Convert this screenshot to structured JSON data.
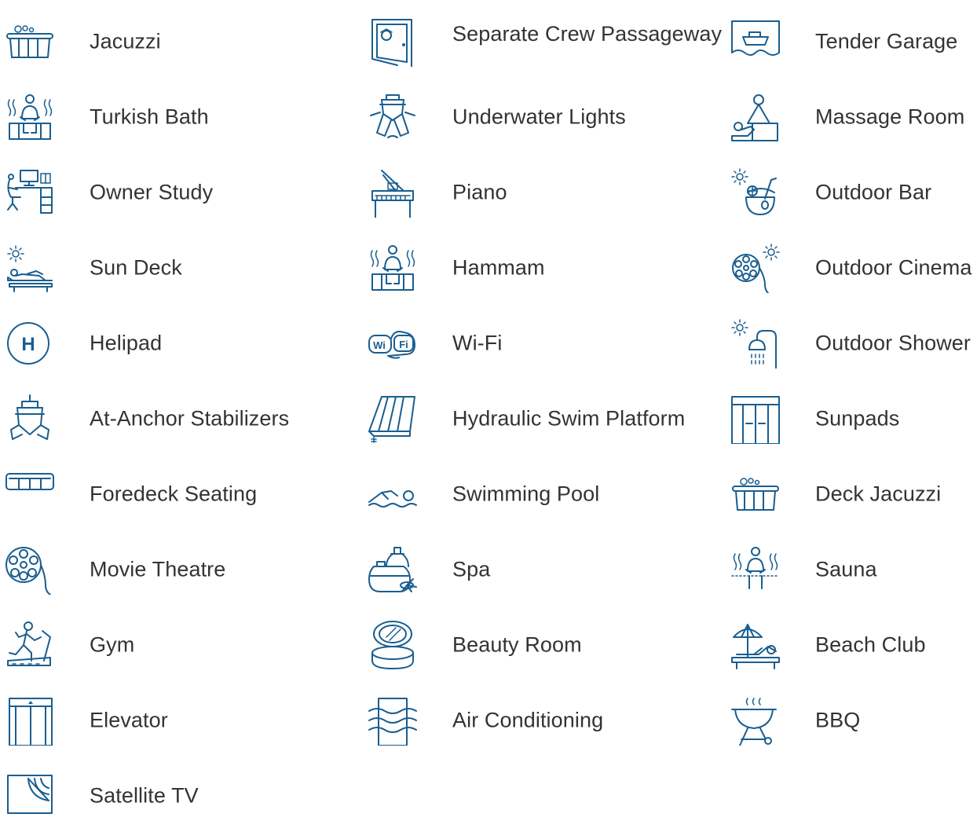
{
  "accent_color": "#1a5e8f",
  "text_color": "#333333",
  "amenities": [
    {
      "label": "Jacuzzi",
      "icon": "jacuzzi-icon"
    },
    {
      "label": "Turkish Bath",
      "icon": "turkish-bath-icon"
    },
    {
      "label": "Owner Study",
      "icon": "owner-study-icon"
    },
    {
      "label": "Sun Deck",
      "icon": "sun-deck-icon"
    },
    {
      "label": "Helipad",
      "icon": "helipad-icon"
    },
    {
      "label": "At-Anchor Stabilizers",
      "icon": "stabilizers-icon"
    },
    {
      "label": "Foredeck Seating",
      "icon": "foredeck-seating-icon"
    },
    {
      "label": "Movie Theatre",
      "icon": "movie-theatre-icon"
    },
    {
      "label": "Gym",
      "icon": "gym-icon"
    },
    {
      "label": "Elevator",
      "icon": "elevator-icon"
    },
    {
      "label": "Satellite TV",
      "icon": "satellite-tv-icon"
    },
    {
      "label": "Separate Crew Passageway",
      "icon": "crew-passageway-icon"
    },
    {
      "label": "Underwater Lights",
      "icon": "underwater-lights-icon"
    },
    {
      "label": "Piano",
      "icon": "piano-icon"
    },
    {
      "label": "Hammam",
      "icon": "hammam-icon"
    },
    {
      "label": "Wi-Fi",
      "icon": "wifi-icon"
    },
    {
      "label": "Hydraulic Swim Platform",
      "icon": "swim-platform-icon"
    },
    {
      "label": "Swimming Pool",
      "icon": "swimming-pool-icon"
    },
    {
      "label": "Spa",
      "icon": "spa-icon"
    },
    {
      "label": "Beauty Room",
      "icon": "beauty-room-icon"
    },
    {
      "label": "Air Conditioning",
      "icon": "air-conditioning-icon"
    },
    {
      "label": "Tender Garage",
      "icon": "tender-garage-icon"
    },
    {
      "label": "Massage Room",
      "icon": "massage-room-icon"
    },
    {
      "label": "Outdoor Bar",
      "icon": "outdoor-bar-icon"
    },
    {
      "label": "Outdoor Cinema",
      "icon": "outdoor-cinema-icon"
    },
    {
      "label": "Outdoor Shower",
      "icon": "outdoor-shower-icon"
    },
    {
      "label": "Sunpads",
      "icon": "sunpads-icon"
    },
    {
      "label": "Deck Jacuzzi",
      "icon": "deck-jacuzzi-icon"
    },
    {
      "label": "Sauna",
      "icon": "sauna-icon"
    },
    {
      "label": "Beach Club",
      "icon": "beach-club-icon"
    },
    {
      "label": "BBQ",
      "icon": "bbq-icon"
    }
  ],
  "helipad_letter": "H",
  "wifi_text_left": "Wi",
  "wifi_text_right": "Fi"
}
